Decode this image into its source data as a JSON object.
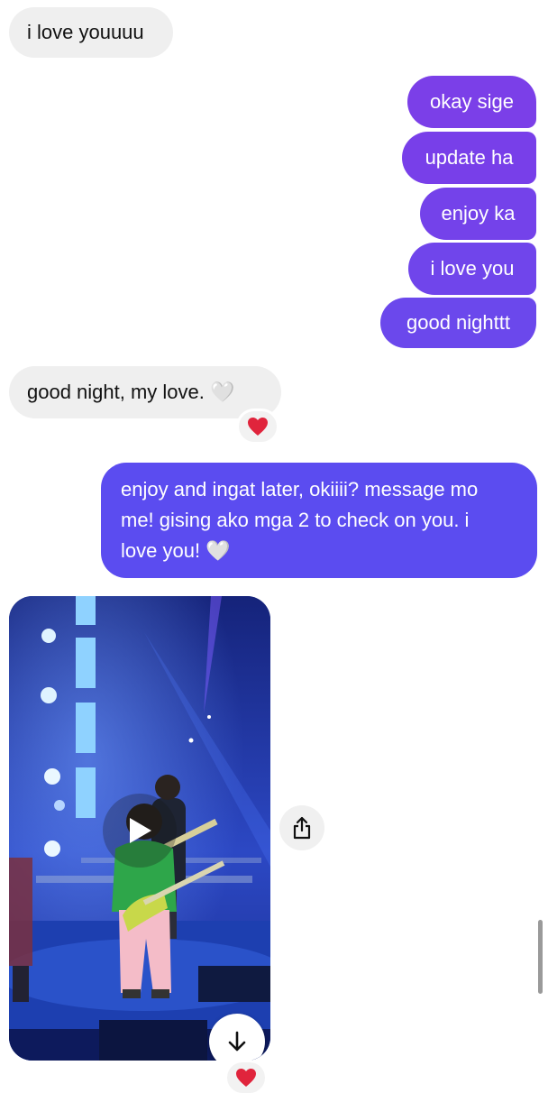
{
  "messages": {
    "m1": "i love youuuu",
    "m2": "okay sige",
    "m3": "update ha",
    "m4": "enjoy ka",
    "m5": "i love you",
    "m6": "good nighttt",
    "m7": "good night, my love. 🤍",
    "m8_line1": "enjoy and ingat later, okiiii? message mo",
    "m8_line2": "me! gising ako mga 2 to check on you. i",
    "m8_line3": "love you! 🤍"
  },
  "reactions": {
    "r1": "❤️",
    "r2": "❤️"
  },
  "colors": {
    "incoming_bubble": "#efefef",
    "outgoing_purple": "#7b3fe8",
    "outgoing_indigo": "#5b4cf0",
    "heart": "#e0243c"
  },
  "icons": {
    "play": "play-icon",
    "share": "share-icon",
    "download": "arrow-down-icon"
  }
}
